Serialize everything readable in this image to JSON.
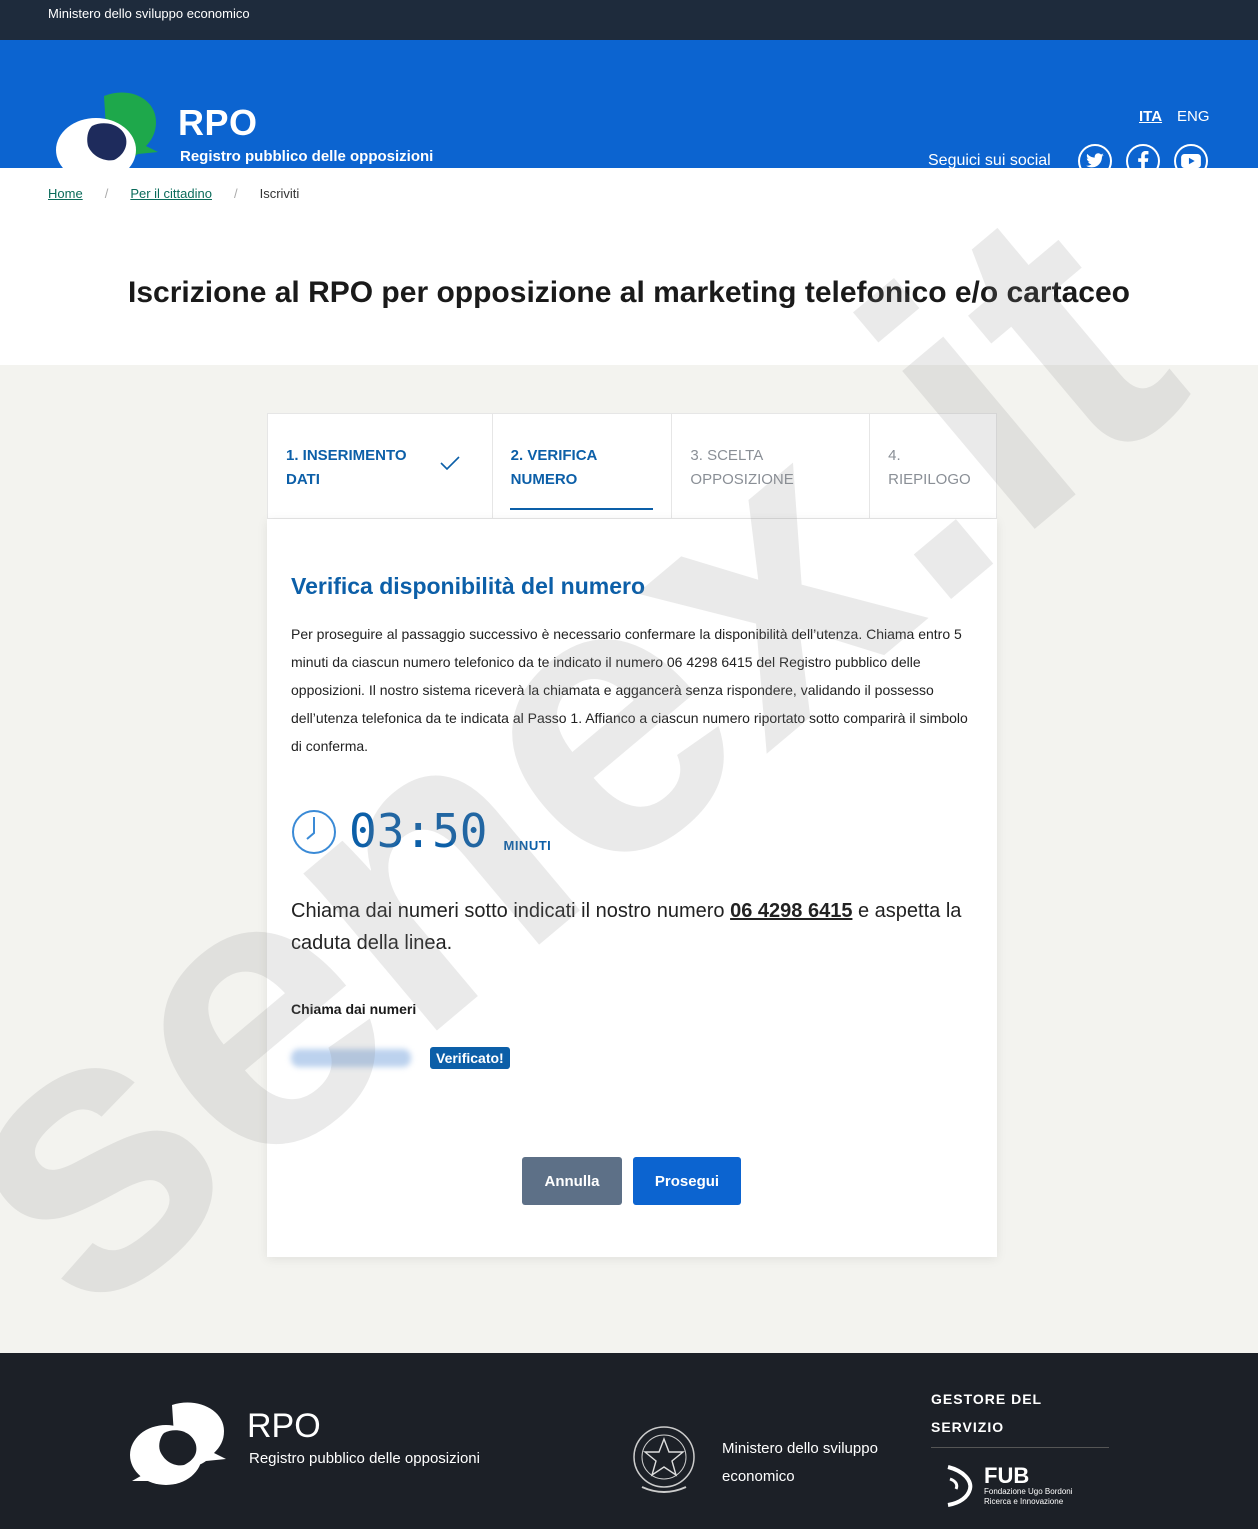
{
  "topbar": {
    "text": "Ministero dello sviluppo economico"
  },
  "header": {
    "title": "RPO",
    "subtitle": "Registro pubblico delle opposizioni",
    "lang_ita": "ITA",
    "lang_eng": "ENG",
    "social_label": "Seguici sui social",
    "social_icons": [
      "twitter-icon",
      "facebook-icon",
      "youtube-icon"
    ]
  },
  "breadcrumb": {
    "home": "Home",
    "citizen": "Per il cittadino",
    "current": "Iscriviti",
    "separator": "/"
  },
  "page": {
    "title": "Iscrizione al RPO per opposizione al marketing telefonico e/o cartaceo"
  },
  "steps": [
    {
      "line1": "1. INSERIMENTO",
      "line2": "DATI",
      "state": "done"
    },
    {
      "line1": "2. VERIFICA",
      "line2": "NUMERO",
      "state": "active"
    },
    {
      "line1": "3. SCELTA",
      "line2": "OPPOSIZIONE",
      "state": "todo"
    },
    {
      "line1": "4.",
      "line2": "RIEPILOGO",
      "state": "todo"
    }
  ],
  "card": {
    "title": "Verifica disponibilità del numero",
    "text": "Per proseguire al passaggio successivo è necessario confermare la disponibilità dell’utenza. Chiama entro 5 minuti da ciascun numero telefonico da te indicato il numero 06 4298 6415 del Registro pubblico delle opposizioni. Il nostro sistema riceverà la chiamata e aggancerà senza rispondere, validando il possesso dell’utenza telefonica da te indicata al Passo 1. Affianco a ciascun numero riportato sotto comparirà il simbolo di conferma.",
    "timer_value": "03:50",
    "timer_unit": "MINUTI",
    "call_before": "Chiama dai numeri sotto indicati il nostro numero ",
    "call_number": "06 4298 6415",
    "call_after": " e aspetta la caduta della linea.",
    "numbers_label": "Chiama dai numeri",
    "verified_badge": "Verificato!",
    "cancel_label": "Annulla",
    "next_label": "Prosegui"
  },
  "footer": {
    "title": "RPO",
    "subtitle": "Registro pubblico delle opposizioni",
    "ministry": "Ministero dello sviluppo economico",
    "gestore": "GESTORE DEL SERVIZIO",
    "fub": "FUB",
    "fub_line1": "Fondazione Ugo Bordoni",
    "fub_line2": "Ricerca e Innovazione"
  },
  "watermark": {
    "text": "senex.it"
  },
  "colors": {
    "header": "#0c64d0",
    "topbar": "#1e2b3c",
    "accent": "#0c5fa8",
    "footer": "#1c2027",
    "logo_green": "#1ea84b"
  }
}
